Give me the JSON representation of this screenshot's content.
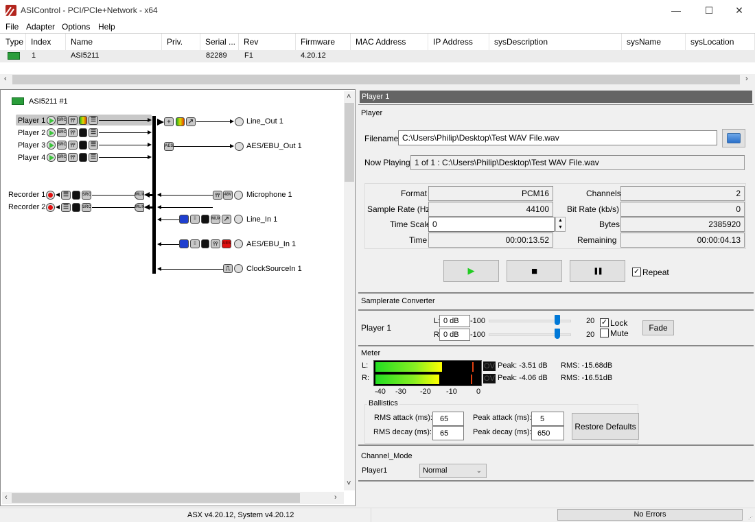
{
  "window": {
    "title": "ASIControl - PCI/PCIe+Network - x64",
    "minimize": "—",
    "maximize": "☐",
    "close": "✕"
  },
  "menu": [
    "File",
    "Adapter",
    "Options",
    "Help"
  ],
  "adapter_table": {
    "columns": [
      "Type",
      "Index",
      "Name",
      "Priv.",
      "Serial ...",
      "Rev",
      "Firmware",
      "MAC Address",
      "IP Address",
      "sysDescription",
      "sysName",
      "sysLocation"
    ],
    "rows": [
      {
        "type_icon": "pci-card-icon",
        "index": "1",
        "name": "ASI5211",
        "priv": "",
        "serial": "82289",
        "rev": "F1",
        "firmware": "4.20.12",
        "mac": "",
        "ip": "",
        "sysDescription": "",
        "sysName": "",
        "sysLocation": ""
      }
    ]
  },
  "graph": {
    "adapter_label": "ASI5211 #1",
    "players": [
      {
        "label": "Player  1",
        "selected": true
      },
      {
        "label": "Player  2",
        "selected": false
      },
      {
        "label": "Player  3",
        "selected": false
      },
      {
        "label": "Player  4",
        "selected": false
      }
    ],
    "recorders": [
      {
        "label": "Recorder  1"
      },
      {
        "label": "Recorder  2"
      }
    ],
    "outputs": [
      {
        "label": "Line_Out  1"
      },
      {
        "label": "AES/EBU_Out  1"
      }
    ],
    "inputs": [
      {
        "label": "Microphone  1"
      },
      {
        "label": "Line_In  1"
      },
      {
        "label": "AES/EBU_In  1"
      },
      {
        "label": "ClockSourceIn  1"
      }
    ],
    "icon_text": {
      "src": "SRC",
      "aes": "AES",
      "mux": "MUX",
      "plus": "+"
    }
  },
  "player_panel": {
    "header": "Player  1",
    "section_title": "Player",
    "filename_label": "Filename",
    "filename_value": "C:\\Users\\Philip\\Desktop\\Test WAV File.wav",
    "now_playing_label": "Now Playing",
    "now_playing_value": "1 of 1 : C:\\Users\\Philip\\Desktop\\Test WAV File.wav",
    "info": {
      "format_label": "Format",
      "format_value": "PCM16",
      "channels_label": "Channels",
      "channels_value": "2",
      "sample_rate_label": "Sample Rate (Hz)",
      "sample_rate_value": "44100",
      "bit_rate_label": "Bit Rate (kb/s)",
      "bit_rate_value": "0",
      "time_scale_label": "Time Scale",
      "time_scale_value": "0",
      "bytes_label": "Bytes",
      "bytes_value": "2385920",
      "time_label": "Time",
      "time_value": "00:00:13.52",
      "remaining_label": "Remaining",
      "remaining_value": "00:00:04.13"
    },
    "transport": {
      "play": "▶",
      "stop": "■",
      "pause": "❚❚",
      "repeat_label": "Repeat",
      "repeat_checked": true
    }
  },
  "src_section": {
    "title": "Samplerate Converter"
  },
  "volume_section": {
    "player_label": "Player  1",
    "left_label": "L:",
    "left_value": "0 dB",
    "right_label": "R:",
    "right_value": "0 dB",
    "min": "-100",
    "max": "20",
    "left_level_db": 0,
    "right_level_db": 0,
    "lock_label": "Lock",
    "lock_checked": true,
    "mute_label": "Mute",
    "mute_checked": false,
    "fade_label": "Fade"
  },
  "meter": {
    "title": "Meter",
    "left_label": "L:",
    "right_label": "R:",
    "ov_label": "OV",
    "left_peak": "Peak: -3.51 dB",
    "left_rms": "RMS: -15.68dB",
    "right_peak": "Peak: -4.06 dB",
    "right_rms": "RMS: -16.51dB",
    "left_rms_db": -15.68,
    "left_peak_db": -3.51,
    "right_rms_db": -16.51,
    "right_peak_db": -4.06,
    "scale_min_db": -42,
    "scale_max_db": 0,
    "ticks": [
      "-40",
      "-30",
      "-20",
      "-10",
      "0"
    ],
    "ballistics": {
      "title": "Ballistics",
      "rms_attack_label": "RMS attack (ms):",
      "rms_attack_value": "65",
      "rms_decay_label": "RMS decay (ms):",
      "rms_decay_value": "65",
      "peak_attack_label": "Peak attack (ms):",
      "peak_attack_value": "5",
      "peak_decay_label": "Peak decay (ms):",
      "peak_decay_value": "650",
      "restore_label": "Restore Defaults"
    }
  },
  "channel_mode": {
    "title": "Channel_Mode",
    "player_label": "Player1",
    "selected": "Normal"
  },
  "status": {
    "version": "ASX v4.20.12, System v4.20.12",
    "errors": "No Errors"
  },
  "colors": {
    "accent": "#0078d7",
    "header_bg": "#646464",
    "play_green": "#22cc22",
    "record_red": "#e01010"
  }
}
